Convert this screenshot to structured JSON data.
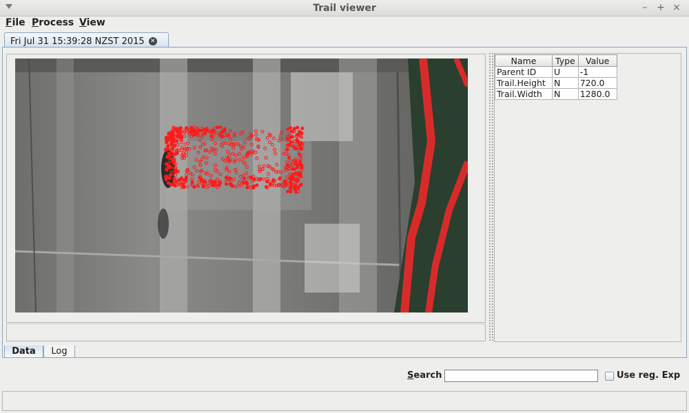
{
  "window": {
    "title": "Trail viewer"
  },
  "menu": {
    "items": [
      {
        "mnemonic": "F",
        "rest": "ile"
      },
      {
        "mnemonic": "P",
        "rest": "rocess"
      },
      {
        "mnemonic": "V",
        "rest": "iew"
      }
    ]
  },
  "document_tab": {
    "label": "Fri Jul 31 15:39:28 NZST 2015"
  },
  "properties": {
    "columns": [
      "Name",
      "Type",
      "Value"
    ],
    "rows": [
      {
        "name": "Parent ID",
        "type": "U",
        "value": "-1"
      },
      {
        "name": "Trail.Height",
        "type": "N",
        "value": "720.0"
      },
      {
        "name": "Trail.Width",
        "type": "N",
        "value": "1280.0"
      }
    ]
  },
  "bottom_tabs": {
    "data_label": "Data",
    "log_label": "Log",
    "active": "Data"
  },
  "search": {
    "label_mnemonic": "S",
    "label_rest": "earch",
    "value": "",
    "regex_label": "Use reg. Exp",
    "regex_checked": false
  },
  "status": {
    "text": ""
  },
  "colors": {
    "accent_border": "#8aa3bd",
    "trail_points": "#ff1a1a"
  }
}
